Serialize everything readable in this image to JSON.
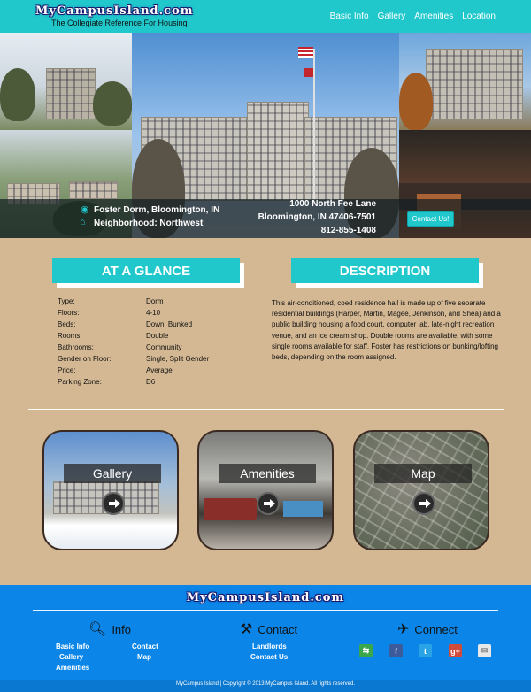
{
  "header": {
    "logo": "MyCampusIsland.com",
    "tagline": "The Collegiate Reference For Housing",
    "nav": [
      "Basic Info",
      "Gallery",
      "Amenities",
      "Location"
    ]
  },
  "hero": {
    "dorm_name": "Foster Dorm, Bloomington, IN",
    "neighborhood": "Neighborhood: Northwest",
    "address_line1": "1000 North Fee Lane",
    "address_line2": "Bloomington, IN 47406-7501",
    "phone": "812-855-1408",
    "contact_button": "Contact Us!"
  },
  "glance": {
    "title": "AT A GLANCE",
    "rows": [
      {
        "label": "Type:",
        "value": "Dorm"
      },
      {
        "label": "Floors:",
        "value": "4-10"
      },
      {
        "label": "Beds:",
        "value": "Down, Bunked"
      },
      {
        "label": "Rooms:",
        "value": "Double"
      },
      {
        "label": "Bathrooms:",
        "value": "Community"
      },
      {
        "label": "Gender on Floor:",
        "value": "Single, Split Gender"
      },
      {
        "label": "Price:",
        "value": "Average"
      },
      {
        "label": "Parking Zone:",
        "value": "D6"
      }
    ]
  },
  "description": {
    "title": "DESCRIPTION",
    "text": "This air-conditioned, coed residence hall is made up of five separate residential buildings (Harper, Martin, Magee, Jenkinson, and Shea) and a public building housing a food court, computer lab, late-night recreation venue, and an ice cream shop. Double rooms are available, with some single rooms available for staff. Foster has restrictions on bunking/lofting beds, depending on the room assigned."
  },
  "tiles": [
    {
      "label": "Gallery"
    },
    {
      "label": "Amenities"
    },
    {
      "label": "Map"
    }
  ],
  "footer": {
    "logo": "MyCampusIsland.com",
    "info_heading": "Info",
    "contact_heading": "Contact",
    "connect_heading": "Connect",
    "info_links_col1": [
      "Basic Info",
      "Gallery",
      "Amenities"
    ],
    "info_links_col2": [
      "Contact",
      "Map"
    ],
    "contact_links": [
      "Landlords",
      "Contact Us"
    ],
    "copyright": "MyCampus Island   |   Copyright © 2013 MyCampus Island. All rights reserved."
  },
  "colors": {
    "accent": "#20c8cc",
    "background": "#d4b893",
    "footer": "#0b86e8"
  },
  "icons": [
    "map-pin-icon",
    "home-icon",
    "play-arrow-icon",
    "search-icon",
    "tools-icon",
    "connect-icon",
    "share-icon",
    "facebook-icon",
    "twitter-icon",
    "google-plus-icon",
    "mail-icon"
  ]
}
